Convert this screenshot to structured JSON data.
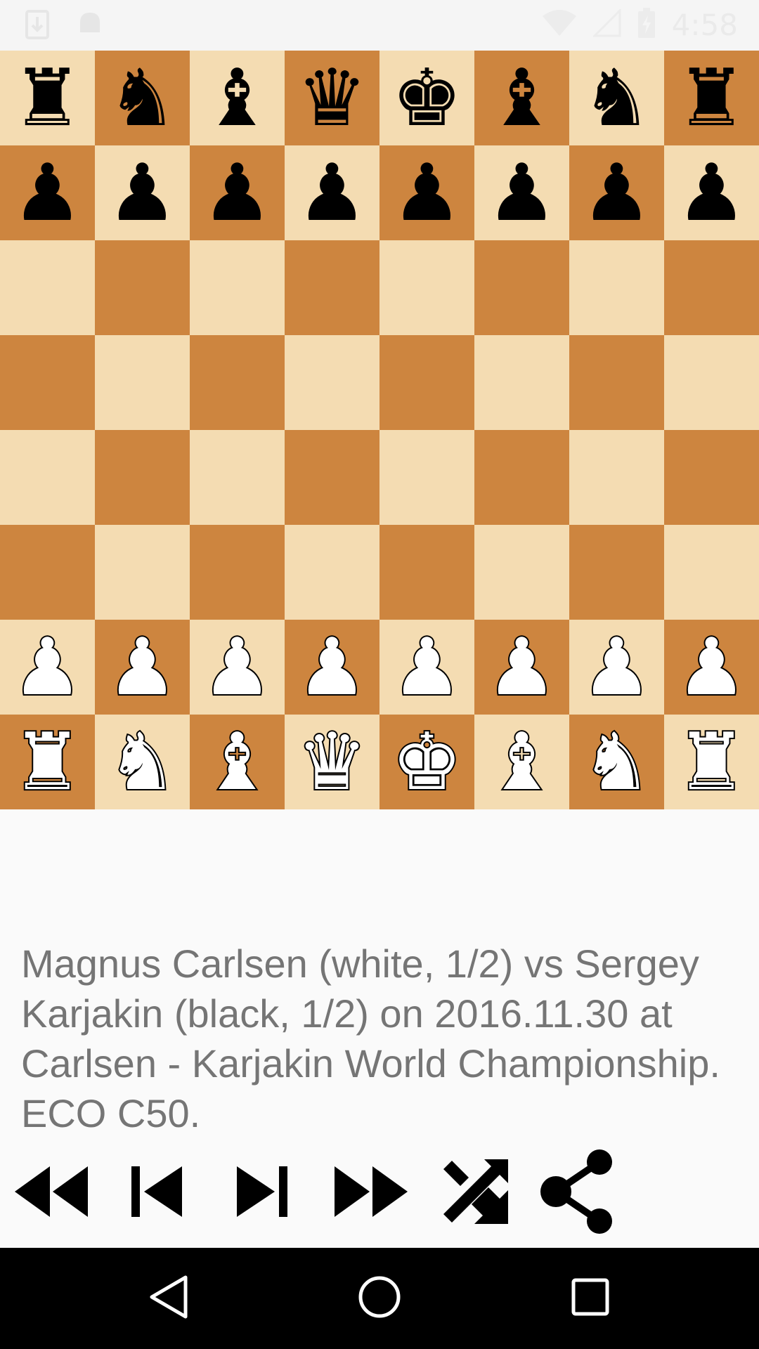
{
  "status_bar": {
    "time": "4:58",
    "icons": [
      "download-notification-icon",
      "android-notification-icon",
      "wifi-icon",
      "cell-signal-icon",
      "battery-charging-icon"
    ]
  },
  "board": {
    "light_color": "#f4dcb2",
    "dark_color": "#cd853f",
    "ranks": [
      [
        [
          "b",
          "rook",
          "♜"
        ],
        [
          "b",
          "knight",
          "♞"
        ],
        [
          "b",
          "bishop",
          "♝"
        ],
        [
          "b",
          "queen",
          "♛"
        ],
        [
          "b",
          "king",
          "♚"
        ],
        [
          "b",
          "bishop",
          "♝"
        ],
        [
          "b",
          "knight",
          "♞"
        ],
        [
          "b",
          "rook",
          "♜"
        ]
      ],
      [
        [
          "b",
          "pawn",
          "♟"
        ],
        [
          "b",
          "pawn",
          "♟"
        ],
        [
          "b",
          "pawn",
          "♟"
        ],
        [
          "b",
          "pawn",
          "♟"
        ],
        [
          "b",
          "pawn",
          "♟"
        ],
        [
          "b",
          "pawn",
          "♟"
        ],
        [
          "b",
          "pawn",
          "♟"
        ],
        [
          "b",
          "pawn",
          "♟"
        ]
      ],
      [
        null,
        null,
        null,
        null,
        null,
        null,
        null,
        null
      ],
      [
        null,
        null,
        null,
        null,
        null,
        null,
        null,
        null
      ],
      [
        null,
        null,
        null,
        null,
        null,
        null,
        null,
        null
      ],
      [
        null,
        null,
        null,
        null,
        null,
        null,
        null,
        null
      ],
      [
        [
          "w",
          "pawn",
          "♟"
        ],
        [
          "w",
          "pawn",
          "♟"
        ],
        [
          "w",
          "pawn",
          "♟"
        ],
        [
          "w",
          "pawn",
          "♟"
        ],
        [
          "w",
          "pawn",
          "♟"
        ],
        [
          "w",
          "pawn",
          "♟"
        ],
        [
          "w",
          "pawn",
          "♟"
        ],
        [
          "w",
          "pawn",
          "♟"
        ]
      ],
      [
        [
          "w",
          "rook",
          "♜"
        ],
        [
          "w",
          "knight",
          "♞"
        ],
        [
          "w",
          "bishop",
          "♝"
        ],
        [
          "w",
          "queen",
          "♛"
        ],
        [
          "w",
          "king",
          "♚"
        ],
        [
          "w",
          "bishop",
          "♝"
        ],
        [
          "w",
          "knight",
          "♞"
        ],
        [
          "w",
          "rook",
          "♜"
        ]
      ]
    ]
  },
  "game_info": "Magnus Carlsen (white, 1/2) vs Sergey Karjakin (black, 1/2) on 2016.11.30 at Carlsen - Karjakin World Championship. ECO C50.",
  "controls": [
    "first-move-icon",
    "previous-move-icon",
    "next-move-icon",
    "last-move-icon",
    "shuffle-icon",
    "share-icon"
  ],
  "nav_bar": [
    "back-icon",
    "home-icon",
    "recents-icon"
  ]
}
